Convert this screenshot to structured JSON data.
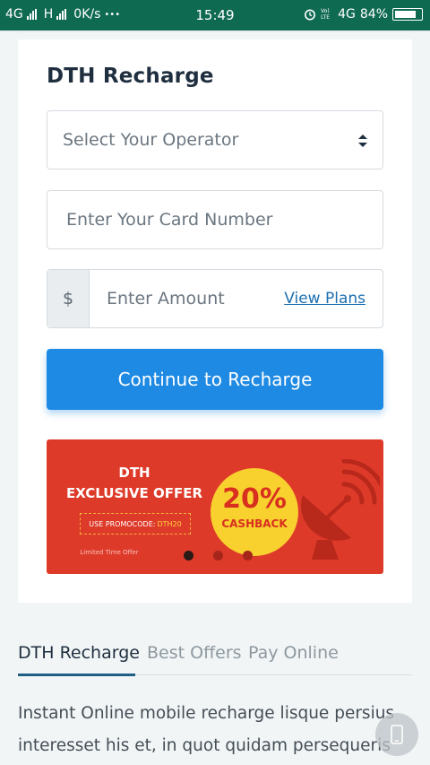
{
  "status_bar": {
    "network_1": "4G",
    "network_2": "H",
    "speed": "0K/s",
    "more": "•••",
    "time": "15:49",
    "volte_label": "Vo) LTE",
    "network_right": "4G",
    "battery_percent": "84%",
    "battery_level": 0.84
  },
  "form": {
    "title": "DTH Recharge",
    "operator_placeholder": "Select Your Operator",
    "card_placeholder": "Enter Your Card Number",
    "currency_symbol": "$",
    "amount_placeholder": "Enter Amount",
    "view_plans_label": "View Plans",
    "continue_label": "Continue to Recharge"
  },
  "banner": {
    "line1": "DTH",
    "line2": "EXCLUSIVE OFFER",
    "promo_prefix": "USE PROMOCODE:",
    "promo_code": "DTH20",
    "limited": "Limited Time Offer",
    "percent": "20%",
    "cashback": "CASHBACK",
    "carousel_active_index": 0,
    "carousel_count": 3
  },
  "tabs": [
    {
      "label": "DTH Recharge",
      "active": true
    },
    {
      "label": "Best Offers",
      "active": false
    },
    {
      "label": "Pay Online",
      "active": false
    }
  ],
  "description": {
    "line1": "Instant Online mobile recharge lisque persius",
    "line2": "interesset his et, in quot quidam persequeris"
  },
  "colors": {
    "status_bar": "#0f6a52",
    "primary_button": "#1e8ae3",
    "banner_red": "#de3a2a",
    "badge_yellow": "#f8d12e",
    "link": "#1d6fb0"
  },
  "icons": {
    "select_caret": "sort-caret-icon",
    "satellite": "satellite-dish-icon",
    "floating_button": "phone-icon"
  }
}
